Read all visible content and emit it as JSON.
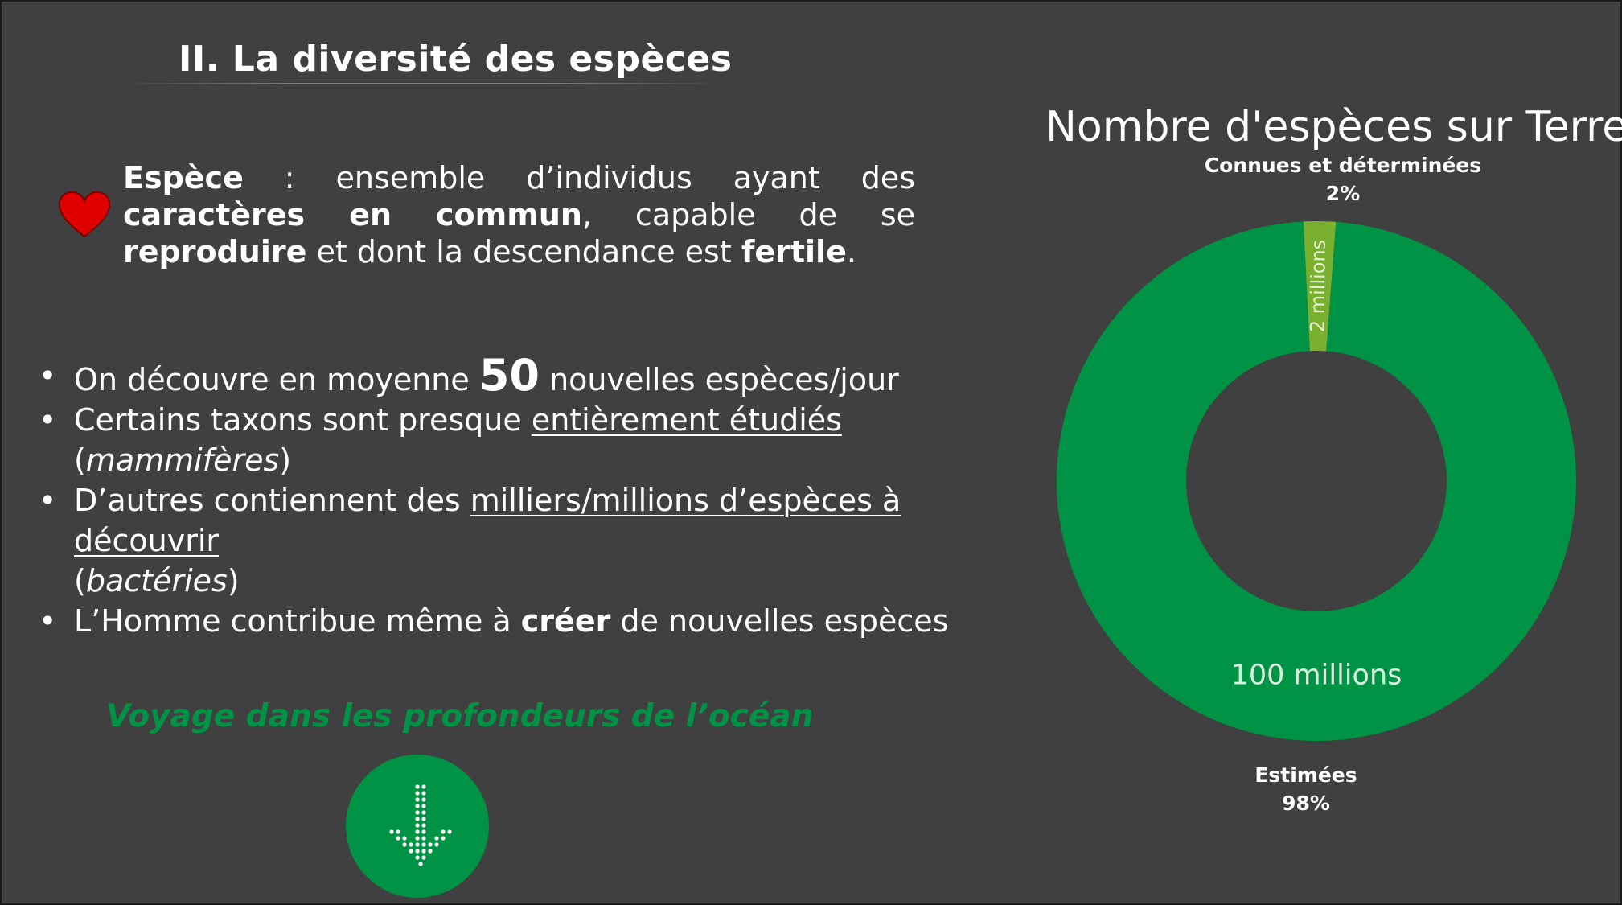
{
  "slide": {
    "title": "II. La diversité des espèces",
    "definition": {
      "term": "Espèce",
      "text_1": " : ensemble d’individus ayant des ",
      "bold_1": "caractères en commun",
      "text_2": ", capable de se ",
      "bold_2": "reproduire",
      "text_3": " et dont la descendance est ",
      "bold_3": "fertile",
      "text_4": "."
    },
    "bullets": [
      {
        "pre": "On découvre en moyenne ",
        "big": "50",
        "post": " nouvelles espèces/jour"
      },
      {
        "pre": "Certains taxons sont presque ",
        "underline": "entièrement étudiés",
        "line2_open": "(",
        "italic": "mammifères",
        "line2_close": ")"
      },
      {
        "pre": "D’autres contiennent des ",
        "underline": "milliers/millions d’espèces à découvrir",
        "line2_open": "(",
        "italic": "bactéries",
        "line2_close": ")"
      },
      {
        "pre": "L’Homme contribue même à ",
        "bold": "créer",
        "post": " de nouvelles espèces"
      }
    ],
    "bullet_glyph": "•",
    "video_link": "Voyage dans les profondeurs de l’océan",
    "icons": {
      "definition_marker": "heart-icon",
      "video_button": "arrow-down-icon"
    },
    "colors": {
      "background": "#404040",
      "accent_green": "#009245",
      "light_green": "#7AB030",
      "heart_red": "#E00000"
    }
  },
  "chart_data": {
    "type": "pie",
    "variant": "donut",
    "title": "Nombre d'espèces sur Terre",
    "slices": [
      {
        "name": "Connues et déterminées",
        "percent": "2%",
        "value": 2,
        "data_label": "2 millions",
        "color": "#7AB030"
      },
      {
        "name": "Estimées",
        "percent": "98%",
        "value": 98,
        "data_label": "100 millions",
        "color": "#009245"
      }
    ]
  }
}
